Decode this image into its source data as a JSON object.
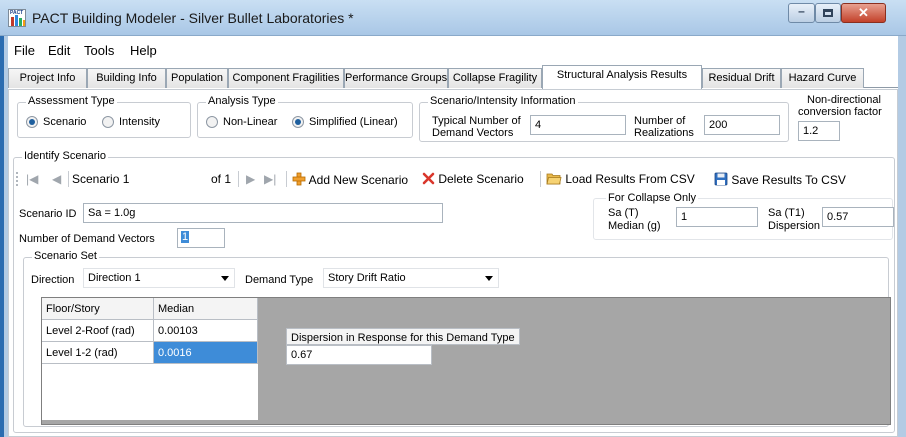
{
  "window": {
    "title": "PACT Building Modeler - Silver Bullet Laboratories *",
    "icon_name": "pact-app-icon",
    "minimize_glyph": "–",
    "close_glyph": "✕"
  },
  "menu": [
    "File",
    "Edit",
    "Tools",
    "Help"
  ],
  "tabs": [
    "Project Info",
    "Building Info",
    "Population",
    "Component Fragilities",
    "Performance Groups",
    "Collapse Fragility",
    "Structural Analysis Results",
    "Residual Drift",
    "Hazard Curve"
  ],
  "active_tab_index": 6,
  "assessment_type": {
    "title": "Assessment Type",
    "options": [
      "Scenario",
      "Intensity"
    ],
    "selected": "Scenario"
  },
  "analysis_type": {
    "title": "Analysis Type",
    "options": [
      "Non-Linear",
      "Simplified (Linear)"
    ],
    "selected": "Simplified (Linear)"
  },
  "scenario_info": {
    "title": "Scenario/Intensity Information",
    "typical_demand_vectors_label_1": "Typical Number of",
    "typical_demand_vectors_label_2": "Demand Vectors",
    "typical_demand_vectors_value": "4",
    "realizations_label_1": "Number of",
    "realizations_label_2": "Realizations",
    "realizations_value": "200"
  },
  "nondirectional": {
    "label_1": "Non-directional",
    "label_2": "conversion factor",
    "value": "1.2"
  },
  "identify_scenario": {
    "title": "Identify Scenario",
    "nav_first": "|◀",
    "nav_prev": "◀",
    "current": "Scenario 1",
    "of_total": "of 1",
    "nav_next": "▶",
    "nav_last": "▶|",
    "add_label": "Add New Scenario",
    "delete_label": "Delete Scenario",
    "load_label": "Load Results From CSV",
    "save_label": "Save Results To CSV",
    "add_icon": "add-plus-icon",
    "delete_icon": "delete-x-icon",
    "load_icon": "folder-open-icon",
    "save_icon": "floppy-disk-icon",
    "scenario_id_label": "Scenario ID",
    "scenario_id_value": "Sa = 1.0g",
    "num_demand_vectors_label": "Number of Demand Vectors",
    "num_demand_vectors_value": "1"
  },
  "collapse_only": {
    "title": "For Collapse Only",
    "sa_median_label_1": "Sa (T)",
    "sa_median_label_2": "Median (g)",
    "sa_median_value": "1",
    "sa_disp_label_1": "Sa (T1)",
    "sa_disp_label_2": "Dispersion",
    "sa_disp_value": "0.57"
  },
  "scenario_set": {
    "title": "Scenario Set",
    "direction_label": "Direction",
    "direction_value": "Direction 1",
    "demand_type_label": "Demand Type",
    "demand_type_value": "Story Drift Ratio"
  },
  "grid": {
    "headers": [
      "Floor/Story",
      "Median"
    ],
    "rows": [
      [
        "Level 2-Roof (rad)",
        "0.00103"
      ],
      [
        "Level 1-2 (rad)",
        "0.0016"
      ]
    ],
    "dispersion_label": "Dispersion in Response for this Demand Type",
    "dispersion_value": "0.67"
  }
}
